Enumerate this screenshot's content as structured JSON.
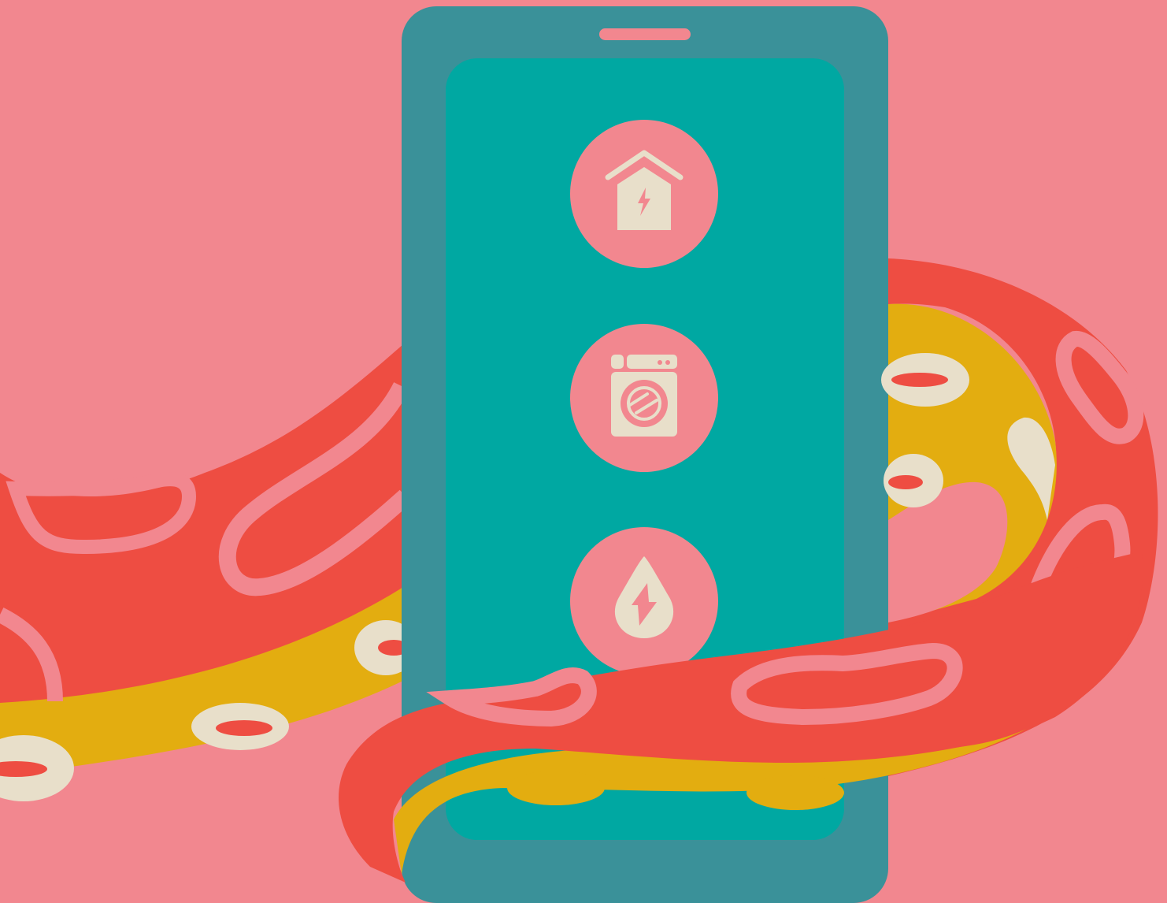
{
  "scene": {
    "description_label": "",
    "colors": {
      "background": "#f2878f",
      "phone_frame": "#3a9199",
      "phone_screen": "#00a8a2",
      "icon_circle": "#f2878f",
      "icon_glyph": "#e8dfca",
      "tentacle_red": "#ee4d42",
      "tentacle_yellow": "#e3ad10",
      "tentacle_bright_yellow": "#f2c700",
      "sucker_cream": "#e8dfca",
      "sucker_outline_pink": "#f2878f"
    }
  },
  "phone": {
    "icons": [
      {
        "name": "smart-home-energy-icon"
      },
      {
        "name": "washing-machine-energy-icon"
      },
      {
        "name": "water-energy-drop-icon"
      }
    ]
  }
}
